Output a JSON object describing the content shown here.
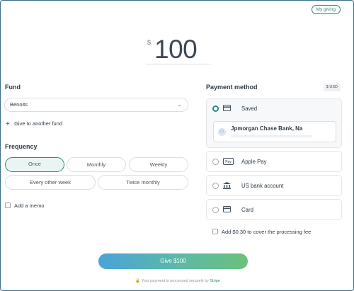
{
  "header": {
    "my_giving_label": "My giving"
  },
  "amount": {
    "currency_symbol": "$",
    "value": "100"
  },
  "fund": {
    "title": "Fund",
    "selected": "Benoits",
    "give_another_label": "Give to another fund"
  },
  "frequency": {
    "title": "Frequency",
    "options": [
      "Once",
      "Monthly",
      "Weekly",
      "Every other week",
      "Twice monthly"
    ],
    "selected": "Once"
  },
  "memo": {
    "label": "Add a memo"
  },
  "payment": {
    "title": "Payment method",
    "currency_badge": "$ USD",
    "methods": [
      {
        "label": "Saved",
        "icon": "wallet-icon",
        "selected": true
      },
      {
        "label": "Apple Pay",
        "icon": "apple-pay-icon",
        "selected": false
      },
      {
        "label": "US bank account",
        "icon": "bank-icon",
        "selected": false
      },
      {
        "label": "Card",
        "icon": "card-icon",
        "selected": false
      }
    ],
    "saved_account": "Jpmorgan Chase Bank, Na",
    "fee_label": "Add $0.30 to cover the processing fee"
  },
  "submit": {
    "label": "Give $100"
  },
  "footer": {
    "secure_text": "Your payment is processed securely by",
    "provider": "Stripe"
  },
  "colors": {
    "accent": "#2a8a7e",
    "button_gradient_start": "#4aa3d8",
    "button_gradient_end": "#6cc07b"
  }
}
